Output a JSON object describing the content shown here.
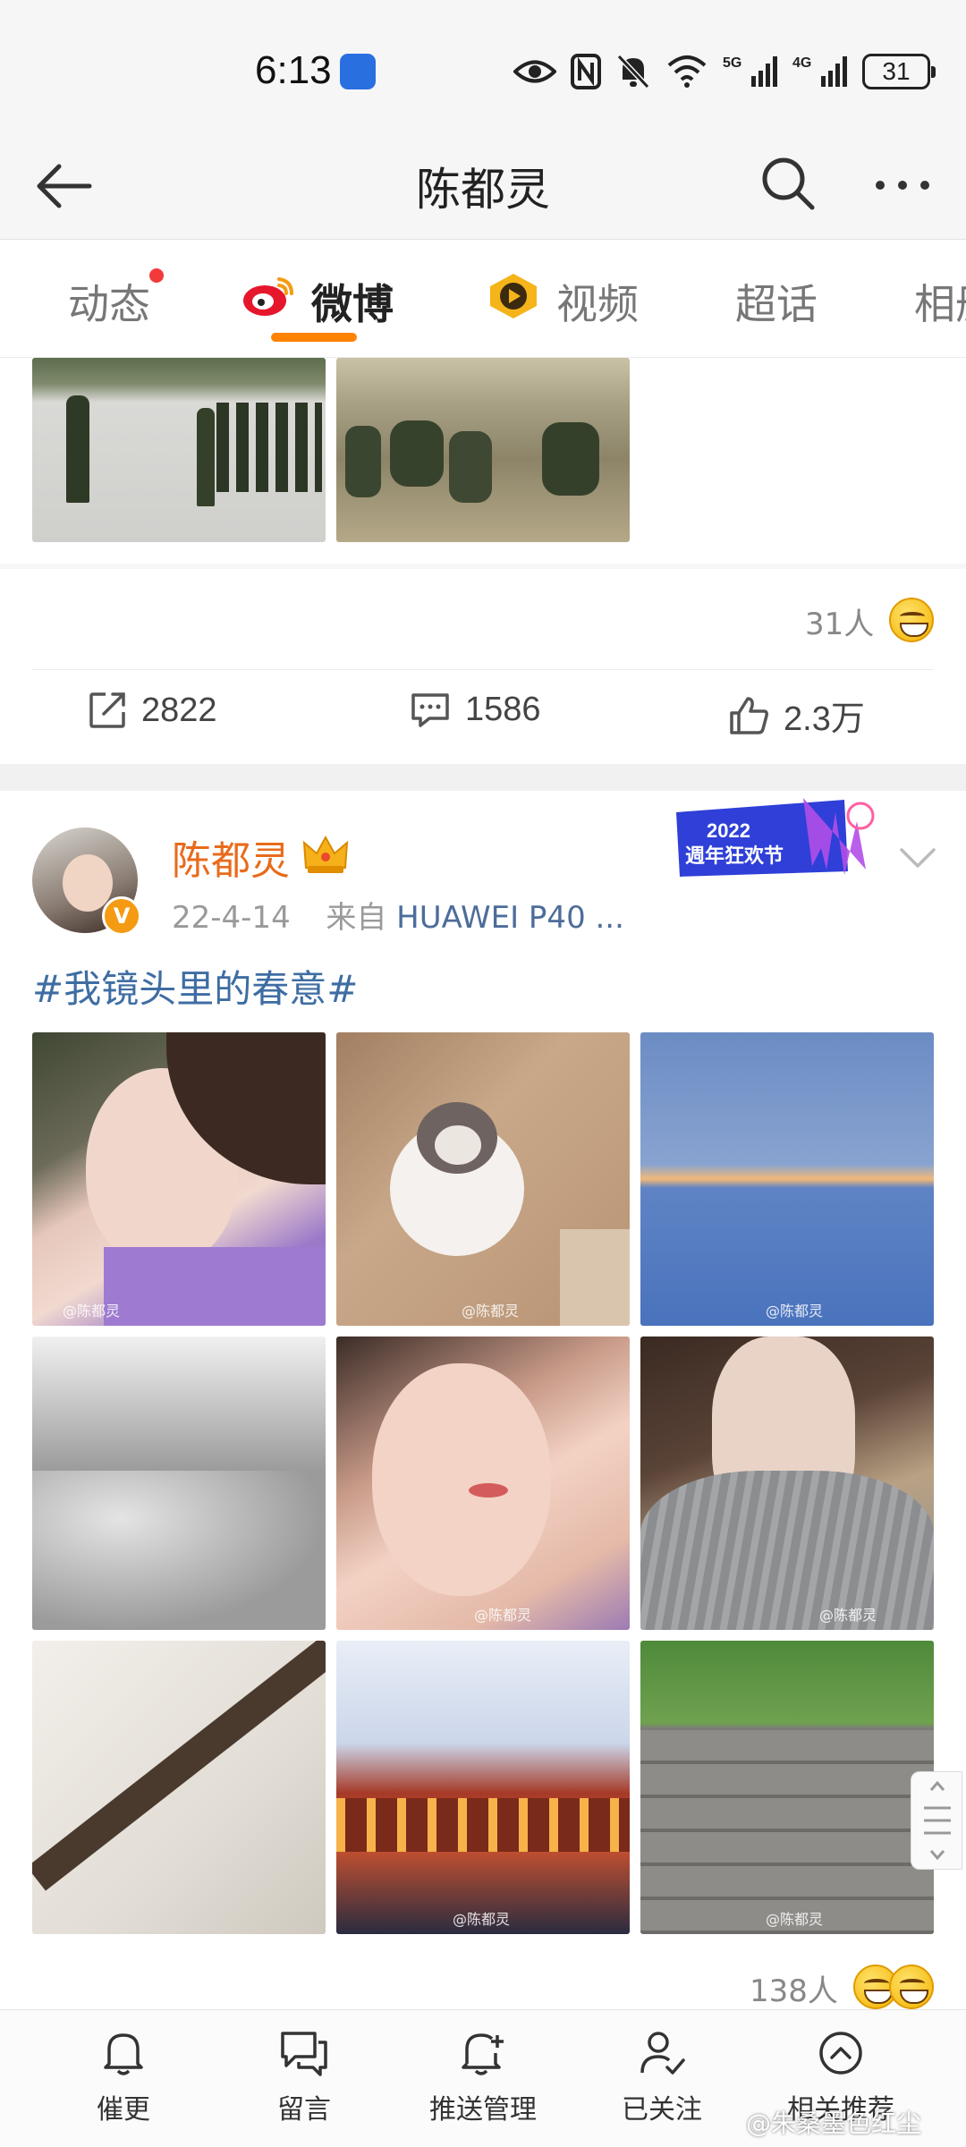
{
  "status_bar": {
    "time": "6:13",
    "battery": "31",
    "signal_1": "5G",
    "signal_2": "4G"
  },
  "header": {
    "title": "陈都灵",
    "icons": [
      "back-arrow-icon",
      "search-icon",
      "more-icon"
    ]
  },
  "tabs": [
    {
      "label": "动态",
      "has_dot": true
    },
    {
      "label": "微博",
      "active": true
    },
    {
      "label": "视频"
    },
    {
      "label": "超话"
    },
    {
      "label": "相册"
    }
  ],
  "post1": {
    "reaction_count": "31人",
    "actions": {
      "repost": "2822",
      "comment": "1586",
      "like": "2.3万"
    }
  },
  "post2": {
    "author": "陈都灵",
    "date": "22-4-14",
    "source_prefix": "来自",
    "source": "HUAWEI P40 ...",
    "promo_badge_year": "2022",
    "promo_badge_text": "週年狂欢节",
    "hashtag": "#我镜头里的春意#",
    "image_watermark": "@陈都灵",
    "reaction_count": "138人"
  },
  "bottom_nav": [
    {
      "label": "催更",
      "icon": "bell-icon"
    },
    {
      "label": "留言",
      "icon": "message-icon"
    },
    {
      "label": "推送管理",
      "icon": "bell-plus-icon"
    },
    {
      "label": "已关注",
      "icon": "user-check-icon"
    },
    {
      "label": "相关推荐",
      "icon": "chevron-up-circle-icon"
    }
  ],
  "watermark": "@朱桑墨色红尘",
  "colors": {
    "accent": "#ff8200",
    "username": "#e86b1c",
    "link": "#3e6da3"
  }
}
